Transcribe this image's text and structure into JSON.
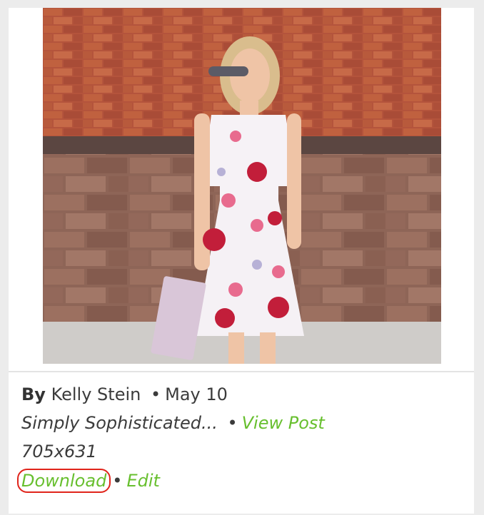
{
  "author": {
    "by_label": "By",
    "name": "Kelly Stein",
    "date": "May 10"
  },
  "post": {
    "title": "Simply Sophisticated...",
    "view_label": "View Post"
  },
  "image": {
    "dimensions": "705x631"
  },
  "actions": {
    "download_label": "Download",
    "edit_label": "Edit"
  },
  "separator": "•",
  "colors": {
    "link": "#67bf2e",
    "highlight": "#e0241b"
  }
}
